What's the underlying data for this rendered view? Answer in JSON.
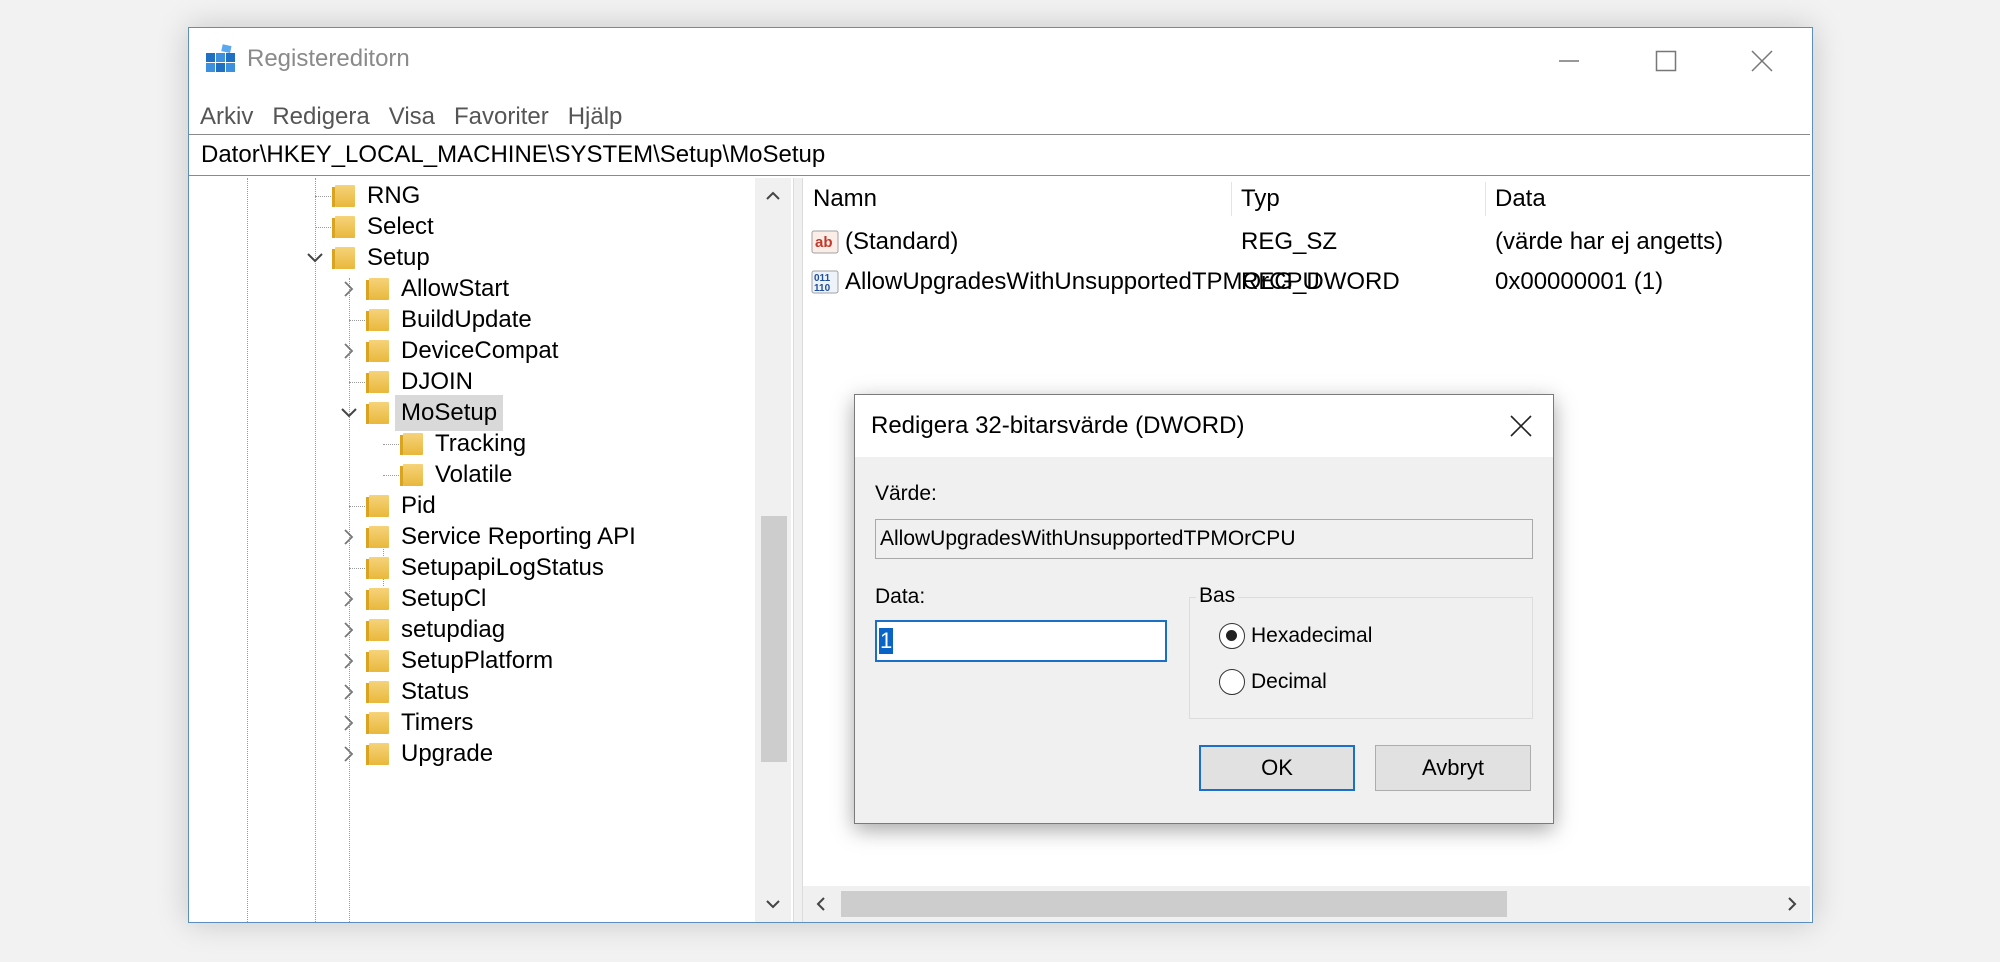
{
  "window": {
    "title": "Registereditorn",
    "menu": [
      "Arkiv",
      "Redigera",
      "Visa",
      "Favoriter",
      "Hjälp"
    ],
    "address": "Dator\\HKEY_LOCAL_MACHINE\\SYSTEM\\Setup\\MoSetup"
  },
  "tree": {
    "items": [
      {
        "label": "RNG",
        "expander": "none",
        "level": 1
      },
      {
        "label": "Select",
        "expander": "none",
        "level": 1
      },
      {
        "label": "Setup",
        "expander": "expanded",
        "level": 1
      },
      {
        "label": "AllowStart",
        "expander": "collapsed",
        "level": 2
      },
      {
        "label": "BuildUpdate",
        "expander": "none",
        "level": 2
      },
      {
        "label": "DeviceCompat",
        "expander": "collapsed",
        "level": 2
      },
      {
        "label": "DJOIN",
        "expander": "none",
        "level": 2
      },
      {
        "label": "MoSetup",
        "expander": "expanded",
        "level": 2,
        "selected": true
      },
      {
        "label": "Tracking",
        "expander": "none",
        "level": 3
      },
      {
        "label": "Volatile",
        "expander": "none",
        "level": 3
      },
      {
        "label": "Pid",
        "expander": "none",
        "level": 2
      },
      {
        "label": "Service Reporting API",
        "expander": "collapsed",
        "level": 2
      },
      {
        "label": "SetupapiLogStatus",
        "expander": "none",
        "level": 2
      },
      {
        "label": "SetupCl",
        "expander": "collapsed",
        "level": 2
      },
      {
        "label": "setupdiag",
        "expander": "collapsed",
        "level": 2
      },
      {
        "label": "SetupPlatform",
        "expander": "collapsed",
        "level": 2
      },
      {
        "label": "Status",
        "expander": "collapsed",
        "level": 2
      },
      {
        "label": "Timers",
        "expander": "collapsed",
        "level": 2
      },
      {
        "label": "Upgrade",
        "expander": "collapsed",
        "level": 2
      }
    ]
  },
  "list": {
    "columns": [
      "Namn",
      "Typ",
      "Data"
    ],
    "rows": [
      {
        "icon": "string-value-icon",
        "name": "(Standard)",
        "type": "REG_SZ",
        "data": "(värde har ej angetts)"
      },
      {
        "icon": "binary-value-icon",
        "name": "AllowUpgradesWithUnsupportedTPMOrCPU",
        "type": "REG_DWORD",
        "data": "0x00000001 (1)"
      }
    ]
  },
  "dialog": {
    "title": "Redigera 32-bitarsvärde (DWORD)",
    "value_name_label": "Värde:",
    "value_name": "AllowUpgradesWithUnsupportedTPMOrCPU",
    "data_label": "Data:",
    "data_value": "1",
    "base_label": "Bas",
    "base_options": [
      {
        "label": "Hexadecimal",
        "checked": true
      },
      {
        "label": "Decimal",
        "checked": false
      }
    ],
    "ok_label": "OK",
    "cancel_label": "Avbryt"
  },
  "colors": {
    "accent": "#1c6fc9",
    "folder": "#e9b83c",
    "selection": "#d9d9d9"
  }
}
